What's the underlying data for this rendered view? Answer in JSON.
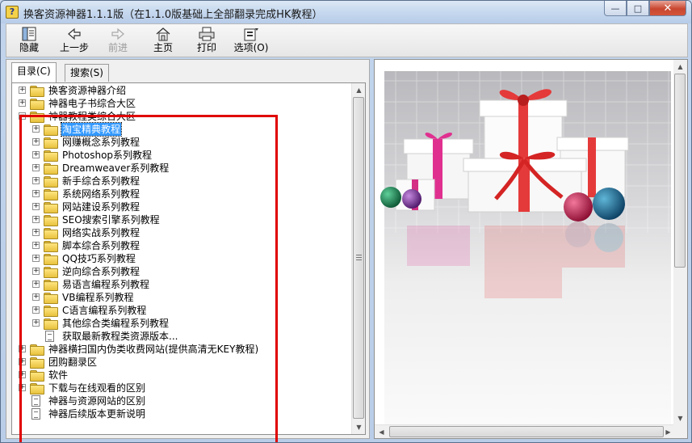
{
  "window": {
    "title": "换客资源神器1.1.1版（在1.1.0版基础上全部翻录完成HK教程）",
    "controls": {
      "minimize": "—",
      "maximize": "□",
      "close": "✕"
    }
  },
  "toolbar": {
    "hide": "隐藏",
    "back": "上一步",
    "forward": "前进",
    "home": "主页",
    "print": "打印",
    "options": "选项(O)"
  },
  "tabs": {
    "contents": "目录(C)",
    "search": "搜索(S)"
  },
  "tree": [
    {
      "label": "换客资源神器介绍",
      "icon": "folder-icon",
      "expander": "+",
      "level": 0,
      "selected": false
    },
    {
      "label": "神器电子书综合大区",
      "icon": "folder-icon",
      "expander": "+",
      "level": 0,
      "selected": false
    },
    {
      "label": "神器教程类综合大区",
      "icon": "folder-open-icon",
      "expander": "−",
      "level": 0,
      "selected": false
    },
    {
      "label": "淘宝精典教程",
      "icon": "folder-icon",
      "expander": "+",
      "level": 1,
      "selected": true
    },
    {
      "label": "网赚概念系列教程",
      "icon": "folder-icon",
      "expander": "+",
      "level": 1,
      "selected": false
    },
    {
      "label": "Photoshop系列教程",
      "icon": "folder-icon",
      "expander": "+",
      "level": 1,
      "selected": false
    },
    {
      "label": "Dreamweaver系列教程",
      "icon": "folder-icon",
      "expander": "+",
      "level": 1,
      "selected": false
    },
    {
      "label": "新手综合系列教程",
      "icon": "folder-icon",
      "expander": "+",
      "level": 1,
      "selected": false
    },
    {
      "label": "系统网络系列教程",
      "icon": "folder-icon",
      "expander": "+",
      "level": 1,
      "selected": false
    },
    {
      "label": "网站建设系列教程",
      "icon": "folder-icon",
      "expander": "+",
      "level": 1,
      "selected": false
    },
    {
      "label": "SEO搜索引擎系列教程",
      "icon": "folder-icon",
      "expander": "+",
      "level": 1,
      "selected": false
    },
    {
      "label": "网络实战系列教程",
      "icon": "folder-icon",
      "expander": "+",
      "level": 1,
      "selected": false
    },
    {
      "label": "脚本综合系列教程",
      "icon": "folder-icon",
      "expander": "+",
      "level": 1,
      "selected": false
    },
    {
      "label": "QQ技巧系列教程",
      "icon": "folder-icon",
      "expander": "+",
      "level": 1,
      "selected": false
    },
    {
      "label": "逆向综合系列教程",
      "icon": "folder-icon",
      "expander": "+",
      "level": 1,
      "selected": false
    },
    {
      "label": "易语言编程系列教程",
      "icon": "folder-icon",
      "expander": "+",
      "level": 1,
      "selected": false
    },
    {
      "label": "VB编程系列教程",
      "icon": "folder-icon",
      "expander": "+",
      "level": 1,
      "selected": false
    },
    {
      "label": "C语言编程系列教程",
      "icon": "folder-icon",
      "expander": "+",
      "level": 1,
      "selected": false
    },
    {
      "label": "其他综合类编程系列教程",
      "icon": "folder-icon",
      "expander": "+",
      "level": 1,
      "selected": false
    },
    {
      "label": "获取最新教程类资源版本...",
      "icon": "document-icon",
      "expander": "",
      "level": 1,
      "selected": false
    },
    {
      "label": "神器横扫国内伪类收费网站(提供高清无KEY教程)",
      "icon": "folder-icon",
      "expander": "+",
      "level": 0,
      "selected": false
    },
    {
      "label": "团购翻录区",
      "icon": "folder-icon",
      "expander": "+",
      "level": 0,
      "selected": false
    },
    {
      "label": "软件",
      "icon": "folder-icon",
      "expander": "+",
      "level": 0,
      "selected": false
    },
    {
      "label": "下载与在线观看的区别",
      "icon": "folder-icon",
      "expander": "+",
      "level": 0,
      "selected": false
    },
    {
      "label": "神器与资源网站的区别",
      "icon": "document-icon",
      "expander": "",
      "level": 0,
      "selected": false
    },
    {
      "label": "神器后续版本更新说明",
      "icon": "document-icon",
      "expander": "",
      "level": 0,
      "selected": false
    }
  ],
  "colors": {
    "highlight_box": "#e00000",
    "selection": "#3399ff"
  }
}
